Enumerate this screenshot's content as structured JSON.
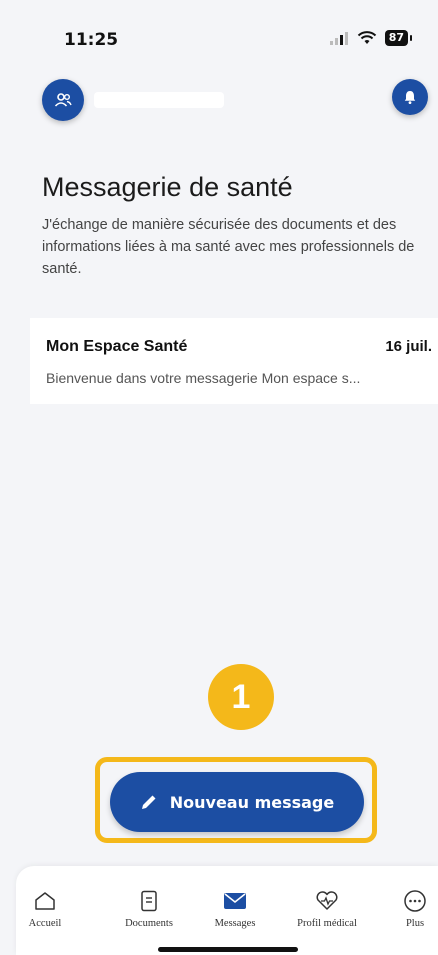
{
  "status_bar": {
    "time": "11:25",
    "battery": "87"
  },
  "header": {
    "avatar_icon": "users-icon",
    "notification_icon": "bell-icon"
  },
  "page": {
    "title": "Messagerie de santé",
    "description": "J'échange de manière sécurisée des documents et des informations liées à ma santé avec mes professionnels de santé."
  },
  "messages": [
    {
      "sender": "Mon Espace Santé",
      "date": "16 juil.",
      "preview": "Bienvenue dans votre messagerie Mon espace s..."
    }
  ],
  "annotation": {
    "step_number": "1"
  },
  "new_message_button": {
    "label": "Nouveau message",
    "icon": "pencil-icon"
  },
  "tab_bar": {
    "items": [
      {
        "label": "Accueil",
        "icon": "home-icon",
        "active": false
      },
      {
        "label": "Documents",
        "icon": "document-icon",
        "active": false
      },
      {
        "label": "Messages",
        "icon": "envelope-icon",
        "active": true
      },
      {
        "label": "Profil médical",
        "icon": "heart-pulse-icon",
        "active": false
      },
      {
        "label": "Plus",
        "icon": "more-icon",
        "active": false
      }
    ]
  },
  "colors": {
    "primary": "#1c4ea3",
    "highlight": "#f4b81a",
    "background": "#f4f5f8"
  }
}
